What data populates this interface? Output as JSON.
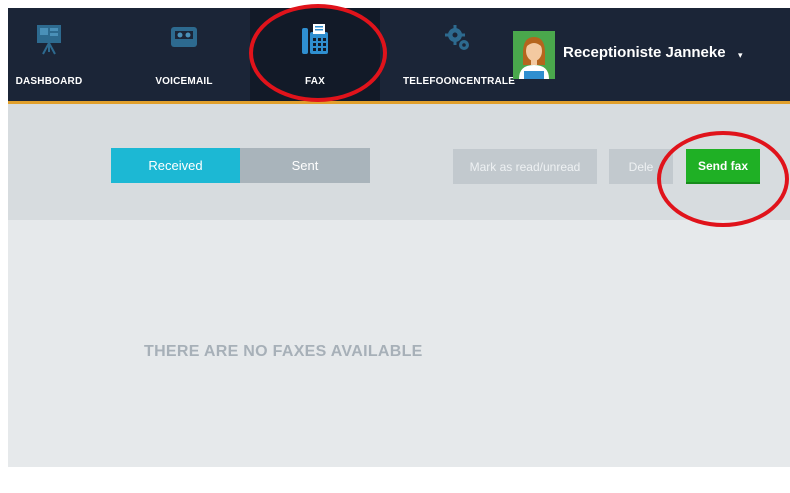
{
  "nav": {
    "items": [
      {
        "label": "DASHBOARD",
        "icon": "presentation-board-icon"
      },
      {
        "label": "VOICEMAIL",
        "icon": "cassette-tape-icon"
      },
      {
        "label": "FAX",
        "icon": "fax-machine-icon",
        "active": true
      },
      {
        "label": "TELEFOONCENTRALE",
        "icon": "gears-icon"
      }
    ]
  },
  "user": {
    "name": "Receptioniste Janneke",
    "caret": "▾"
  },
  "toolbar": {
    "tabs": [
      {
        "label": "Received",
        "active": true
      },
      {
        "label": "Sent",
        "active": false
      }
    ],
    "mark_label": "Mark as read/unread",
    "delete_label": "Dele",
    "send_label": "Send fax"
  },
  "main": {
    "empty_message": "THERE ARE NO FAXES AVAILABLE"
  },
  "colors": {
    "topbar": "#1b2537",
    "accent_border": "#e1a02c",
    "tab_active": "#1cb8d4",
    "send_button": "#1fb025",
    "annotation_circle": "#e0131b"
  }
}
